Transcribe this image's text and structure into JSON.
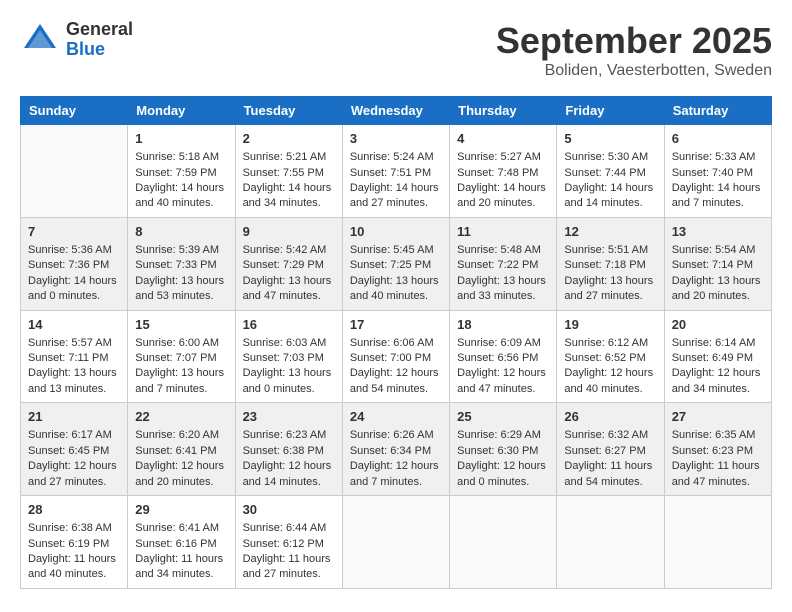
{
  "header": {
    "logo_general": "General",
    "logo_blue": "Blue",
    "month": "September 2025",
    "location": "Boliden, Vaesterbotten, Sweden"
  },
  "days_of_week": [
    "Sunday",
    "Monday",
    "Tuesday",
    "Wednesday",
    "Thursday",
    "Friday",
    "Saturday"
  ],
  "weeks": [
    [
      {
        "day": "",
        "info": ""
      },
      {
        "day": "1",
        "info": "Sunrise: 5:18 AM\nSunset: 7:59 PM\nDaylight: 14 hours\nand 40 minutes."
      },
      {
        "day": "2",
        "info": "Sunrise: 5:21 AM\nSunset: 7:55 PM\nDaylight: 14 hours\nand 34 minutes."
      },
      {
        "day": "3",
        "info": "Sunrise: 5:24 AM\nSunset: 7:51 PM\nDaylight: 14 hours\nand 27 minutes."
      },
      {
        "day": "4",
        "info": "Sunrise: 5:27 AM\nSunset: 7:48 PM\nDaylight: 14 hours\nand 20 minutes."
      },
      {
        "day": "5",
        "info": "Sunrise: 5:30 AM\nSunset: 7:44 PM\nDaylight: 14 hours\nand 14 minutes."
      },
      {
        "day": "6",
        "info": "Sunrise: 5:33 AM\nSunset: 7:40 PM\nDaylight: 14 hours\nand 7 minutes."
      }
    ],
    [
      {
        "day": "7",
        "info": "Sunrise: 5:36 AM\nSunset: 7:36 PM\nDaylight: 14 hours\nand 0 minutes."
      },
      {
        "day": "8",
        "info": "Sunrise: 5:39 AM\nSunset: 7:33 PM\nDaylight: 13 hours\nand 53 minutes."
      },
      {
        "day": "9",
        "info": "Sunrise: 5:42 AM\nSunset: 7:29 PM\nDaylight: 13 hours\nand 47 minutes."
      },
      {
        "day": "10",
        "info": "Sunrise: 5:45 AM\nSunset: 7:25 PM\nDaylight: 13 hours\nand 40 minutes."
      },
      {
        "day": "11",
        "info": "Sunrise: 5:48 AM\nSunset: 7:22 PM\nDaylight: 13 hours\nand 33 minutes."
      },
      {
        "day": "12",
        "info": "Sunrise: 5:51 AM\nSunset: 7:18 PM\nDaylight: 13 hours\nand 27 minutes."
      },
      {
        "day": "13",
        "info": "Sunrise: 5:54 AM\nSunset: 7:14 PM\nDaylight: 13 hours\nand 20 minutes."
      }
    ],
    [
      {
        "day": "14",
        "info": "Sunrise: 5:57 AM\nSunset: 7:11 PM\nDaylight: 13 hours\nand 13 minutes."
      },
      {
        "day": "15",
        "info": "Sunrise: 6:00 AM\nSunset: 7:07 PM\nDaylight: 13 hours\nand 7 minutes."
      },
      {
        "day": "16",
        "info": "Sunrise: 6:03 AM\nSunset: 7:03 PM\nDaylight: 13 hours\nand 0 minutes."
      },
      {
        "day": "17",
        "info": "Sunrise: 6:06 AM\nSunset: 7:00 PM\nDaylight: 12 hours\nand 54 minutes."
      },
      {
        "day": "18",
        "info": "Sunrise: 6:09 AM\nSunset: 6:56 PM\nDaylight: 12 hours\nand 47 minutes."
      },
      {
        "day": "19",
        "info": "Sunrise: 6:12 AM\nSunset: 6:52 PM\nDaylight: 12 hours\nand 40 minutes."
      },
      {
        "day": "20",
        "info": "Sunrise: 6:14 AM\nSunset: 6:49 PM\nDaylight: 12 hours\nand 34 minutes."
      }
    ],
    [
      {
        "day": "21",
        "info": "Sunrise: 6:17 AM\nSunset: 6:45 PM\nDaylight: 12 hours\nand 27 minutes."
      },
      {
        "day": "22",
        "info": "Sunrise: 6:20 AM\nSunset: 6:41 PM\nDaylight: 12 hours\nand 20 minutes."
      },
      {
        "day": "23",
        "info": "Sunrise: 6:23 AM\nSunset: 6:38 PM\nDaylight: 12 hours\nand 14 minutes."
      },
      {
        "day": "24",
        "info": "Sunrise: 6:26 AM\nSunset: 6:34 PM\nDaylight: 12 hours\nand 7 minutes."
      },
      {
        "day": "25",
        "info": "Sunrise: 6:29 AM\nSunset: 6:30 PM\nDaylight: 12 hours\nand 0 minutes."
      },
      {
        "day": "26",
        "info": "Sunrise: 6:32 AM\nSunset: 6:27 PM\nDaylight: 11 hours\nand 54 minutes."
      },
      {
        "day": "27",
        "info": "Sunrise: 6:35 AM\nSunset: 6:23 PM\nDaylight: 11 hours\nand 47 minutes."
      }
    ],
    [
      {
        "day": "28",
        "info": "Sunrise: 6:38 AM\nSunset: 6:19 PM\nDaylight: 11 hours\nand 40 minutes."
      },
      {
        "day": "29",
        "info": "Sunrise: 6:41 AM\nSunset: 6:16 PM\nDaylight: 11 hours\nand 34 minutes."
      },
      {
        "day": "30",
        "info": "Sunrise: 6:44 AM\nSunset: 6:12 PM\nDaylight: 11 hours\nand 27 minutes."
      },
      {
        "day": "",
        "info": ""
      },
      {
        "day": "",
        "info": ""
      },
      {
        "day": "",
        "info": ""
      },
      {
        "day": "",
        "info": ""
      }
    ]
  ]
}
